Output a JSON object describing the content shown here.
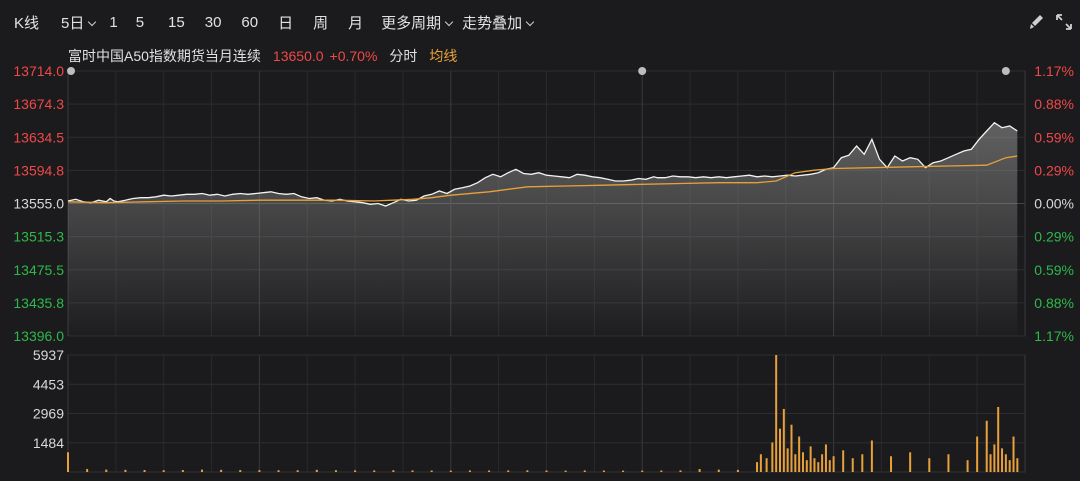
{
  "toolbar": {
    "kline": "K线",
    "period": "5日",
    "periods": [
      "1",
      "5",
      "15",
      "30",
      "60",
      "日",
      "周",
      "月"
    ],
    "more_periods": "更多周期",
    "overlay": "走势叠加"
  },
  "info": {
    "name": "富时中国A50指数期货当月连续",
    "price": "13650.0",
    "change": "+0.70%",
    "fenshi": "分时",
    "avg": "均线"
  },
  "colors": {
    "background": "#1b1b1d",
    "up": "#f04848",
    "down": "#2fb84a",
    "price_line": "#f2f2f2",
    "avg_line": "#e8a13a",
    "volume": "#e8a13a"
  },
  "chart_data": [
    {
      "type": "line",
      "title": "富时中国A50指数期货当月连续",
      "days": 5,
      "y_left_ticks": [
        "13714.0",
        "13674.3",
        "13634.5",
        "13594.8",
        "13555.0",
        "13515.3",
        "13475.5",
        "13435.8",
        "13396.0"
      ],
      "y_right_ticks": [
        "1.17%",
        "0.88%",
        "0.59%",
        "0.29%",
        "0.00%",
        "0.29%",
        "0.59%",
        "0.88%",
        "1.17%"
      ],
      "ylim": [
        13396.0,
        13714.0
      ],
      "reference": 13555.0,
      "series": [
        {
          "x": [
            0.0,
            0.04,
            0.08,
            0.12,
            0.16,
            0.2,
            0.22,
            0.24,
            0.26,
            0.3,
            0.34,
            0.38,
            0.42,
            0.46,
            0.5,
            0.54,
            0.58,
            0.62,
            0.66,
            0.7,
            0.72,
            0.74,
            0.78,
            0.82,
            0.86,
            0.9,
            0.94,
            0.98,
            1.02,
            1.06,
            1.1,
            1.14,
            1.18,
            1.22,
            1.26,
            1.3,
            1.34,
            1.38,
            1.42,
            1.46,
            1.5,
            1.54,
            1.58,
            1.62,
            1.66,
            1.7,
            1.74,
            1.78,
            1.82,
            1.86,
            1.9,
            1.94,
            1.98,
            2.02,
            2.06,
            2.1,
            2.14,
            2.18,
            2.22,
            2.26,
            2.3,
            2.34,
            2.38,
            2.42,
            2.46,
            2.5,
            2.54,
            2.58,
            2.62,
            2.66,
            2.7,
            2.74,
            2.78,
            2.82,
            2.86,
            2.9,
            2.94,
            2.98,
            3.02,
            3.06,
            3.08,
            3.12,
            3.16,
            3.2,
            3.24,
            3.28,
            3.32,
            3.36,
            3.4,
            3.44,
            3.48,
            3.52,
            3.56,
            3.6,
            3.64,
            3.68,
            3.72,
            3.76,
            3.8,
            3.84,
            3.88,
            3.92,
            3.96,
            4.0,
            4.04,
            4.08,
            4.12,
            4.16,
            4.2,
            4.24,
            4.28,
            4.32,
            4.36,
            4.4,
            4.44,
            4.48,
            4.52,
            4.56,
            4.6,
            4.64,
            4.68,
            4.72,
            4.76,
            4.8,
            4.84,
            4.88,
            4.92,
            4.96
          ],
          "values": [
            13558,
            13560,
            13557,
            13556,
            13559,
            13557,
            13561,
            13558,
            13557,
            13559,
            13561,
            13562,
            13562,
            13563,
            13565,
            13564,
            13565,
            13566,
            13566,
            13567,
            13566,
            13565,
            13566,
            13564,
            13566,
            13567,
            13566,
            13567,
            13568,
            13569,
            13567,
            13566,
            13567,
            13563,
            13561,
            13562,
            13559,
            13558,
            13560,
            13558,
            13557,
            13556,
            13554,
            13555,
            13552,
            13556,
            13560,
            13558,
            13559,
            13564,
            13566,
            13570,
            13567,
            13572,
            13574,
            13576,
            13580,
            13586,
            13590,
            13587,
            13592,
            13596,
            13591,
            13590,
            13592,
            13589,
            13588,
            13587,
            13586,
            13590,
            13589,
            13587,
            13586,
            13584,
            13582,
            13582,
            13583,
            13585,
            13584,
            13587,
            13586,
            13586,
            13588,
            13587,
            13587,
            13586,
            13587,
            13586,
            13587,
            13586,
            13587,
            13588,
            13589,
            13587,
            13588,
            13587,
            13588,
            13589,
            13588,
            13589,
            13590,
            13592,
            13596,
            13598,
            13610,
            13613,
            13624,
            13614,
            13632,
            13608,
            13598,
            13612,
            13606,
            13610,
            13608,
            13598,
            13604,
            13606,
            13610,
            13614,
            13618,
            13620,
            13632,
            13642,
            13652,
            13646,
            13648,
            13642
          ]
        },
        {
          "name": "均线",
          "x": [
            0.0,
            0.2,
            0.4,
            0.6,
            0.8,
            1.0,
            1.2,
            1.4,
            1.6,
            1.8,
            1.9,
            2.0,
            2.2,
            2.4,
            2.6,
            2.8,
            3.0,
            3.2,
            3.4,
            3.6,
            3.7,
            3.8,
            3.9,
            4.0,
            4.2,
            4.4,
            4.6,
            4.8,
            4.9,
            4.96
          ],
          "values": [
            13557,
            13556,
            13557,
            13558,
            13558,
            13559,
            13559,
            13559,
            13558,
            13560,
            13562,
            13565,
            13569,
            13575,
            13576,
            13577,
            13578,
            13579,
            13580,
            13580,
            13582,
            13592,
            13595,
            13597,
            13598,
            13599,
            13600,
            13601,
            13610,
            13612
          ]
        }
      ]
    },
    {
      "type": "bar",
      "y_ticks": [
        "5937",
        "4453",
        "2969",
        "1484"
      ],
      "ylim": [
        0,
        5937
      ],
      "x": [
        0.0,
        0.1,
        0.2,
        0.3,
        0.4,
        0.5,
        0.6,
        0.7,
        0.8,
        0.9,
        1.0,
        1.1,
        1.2,
        1.3,
        1.4,
        1.5,
        1.6,
        1.7,
        1.8,
        1.9,
        2.0,
        2.1,
        2.2,
        2.3,
        2.4,
        2.5,
        2.6,
        2.7,
        2.8,
        2.9,
        3.0,
        3.1,
        3.2,
        3.3,
        3.4,
        3.5,
        3.6,
        3.62,
        3.65,
        3.68,
        3.7,
        3.72,
        3.74,
        3.76,
        3.78,
        3.8,
        3.82,
        3.84,
        3.86,
        3.88,
        3.9,
        3.92,
        3.94,
        3.96,
        3.98,
        4.0,
        4.05,
        4.1,
        4.15,
        4.2,
        4.3,
        4.4,
        4.5,
        4.6,
        4.7,
        4.75,
        4.8,
        4.82,
        4.84,
        4.86,
        4.88,
        4.9,
        4.92,
        4.94,
        4.96
      ],
      "values": [
        1000,
        150,
        120,
        110,
        100,
        90,
        100,
        120,
        110,
        100,
        95,
        90,
        90,
        110,
        90,
        85,
        80,
        90,
        80,
        75,
        70,
        80,
        75,
        80,
        85,
        75,
        70,
        80,
        75,
        70,
        70,
        75,
        80,
        150,
        120,
        110,
        500,
        900,
        700,
        1500,
        5937,
        2200,
        3200,
        1200,
        2400,
        900,
        1800,
        1000,
        600,
        1300,
        700,
        500,
        900,
        1400,
        600,
        800,
        1100,
        700,
        900,
        1600,
        800,
        1000,
        700,
        900,
        600,
        1800,
        2600,
        900,
        1400,
        3300,
        1200,
        900,
        600,
        1800,
        700
      ]
    }
  ]
}
